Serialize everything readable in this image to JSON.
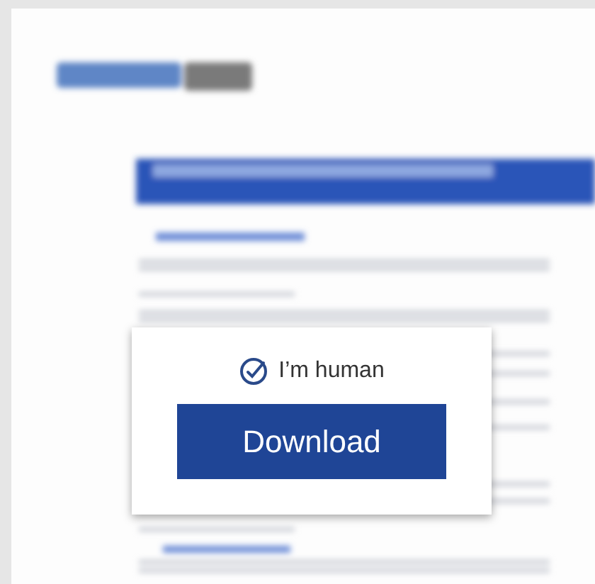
{
  "verification": {
    "label": "I’m human",
    "checked": true
  },
  "download_button": {
    "label": "Download"
  }
}
